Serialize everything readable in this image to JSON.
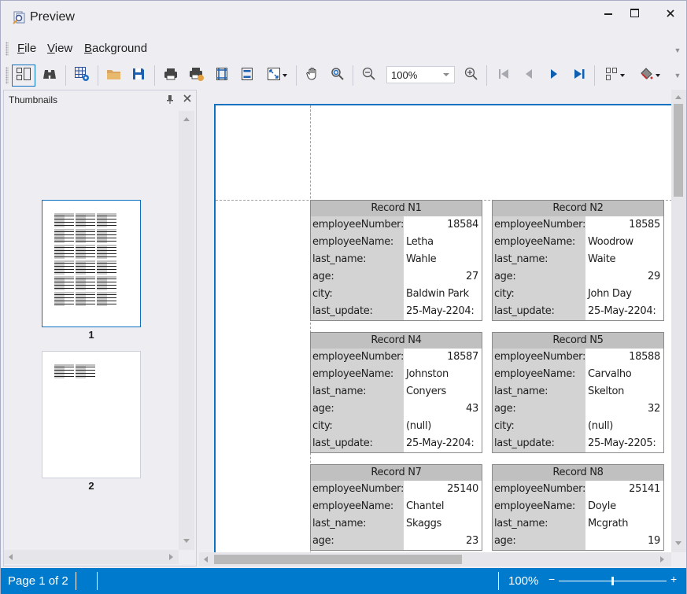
{
  "window": {
    "title": "Preview",
    "icon": "preview-app-icon",
    "controls": [
      "minimize-icon",
      "maximize-icon",
      "close-icon"
    ]
  },
  "menu": {
    "items": [
      {
        "label": "File",
        "mnemonic": "F"
      },
      {
        "label": "View",
        "mnemonic": "V"
      },
      {
        "label": "Background",
        "mnemonic": "B"
      }
    ]
  },
  "toolbar": {
    "buttons": [
      {
        "name": "thumbnails-toggle",
        "icon": "thumbnails-icon",
        "active": true
      },
      {
        "name": "find",
        "icon": "binoculars-icon"
      },
      {
        "name": "parameters",
        "icon": "grid-gear-icon"
      },
      {
        "name": "open",
        "icon": "folder-open-icon"
      },
      {
        "name": "save",
        "icon": "save-icon"
      },
      {
        "name": "print",
        "icon": "printer-icon"
      },
      {
        "name": "quick-print",
        "icon": "quick-print-icon"
      },
      {
        "name": "page-setup",
        "icon": "page-margins-icon"
      },
      {
        "name": "header-footer",
        "icon": "header-footer-icon"
      },
      {
        "name": "scale",
        "icon": "scale-icon",
        "dropdown": true
      },
      {
        "name": "hand-tool",
        "icon": "hand-icon"
      },
      {
        "name": "magnifier",
        "icon": "magnifier-icon"
      },
      {
        "name": "zoom-out",
        "icon": "zoom-out-icon"
      },
      {
        "name": "zoom-in",
        "icon": "zoom-in-icon"
      },
      {
        "name": "first-page",
        "icon": "first-page-icon",
        "disabled": true
      },
      {
        "name": "previous-page",
        "icon": "previous-page-icon",
        "disabled": true
      },
      {
        "name": "next-page",
        "icon": "next-page-icon"
      },
      {
        "name": "last-page",
        "icon": "last-page-icon"
      },
      {
        "name": "multiple-pages",
        "icon": "multiple-pages-icon",
        "dropdown": true
      },
      {
        "name": "page-color",
        "icon": "paint-bucket-icon",
        "dropdown": true
      }
    ],
    "zoom_value": "100%"
  },
  "thumbnails": {
    "title": "Thumbnails",
    "pages": [
      {
        "label": "1",
        "selected": true,
        "records": 18
      },
      {
        "label": "2",
        "selected": false,
        "records": 2
      }
    ]
  },
  "records": [
    {
      "title": "Record N1",
      "employeeNumber": "18584",
      "employeeName": "Letha",
      "last_name": "Wahle",
      "age": "27",
      "city": "Baldwin Park",
      "last_update": "25-May-2204:"
    },
    {
      "title": "Record N2",
      "employeeNumber": "18585",
      "employeeName": "Woodrow",
      "last_name": "Waite",
      "age": "29",
      "city": "John Day",
      "last_update": "25-May-2204:"
    },
    {
      "title": "Record N4",
      "employeeNumber": "18587",
      "employeeName": "Johnston",
      "last_name": "Conyers",
      "age": "43",
      "city": "(null)",
      "last_update": "25-May-2204:"
    },
    {
      "title": "Record N5",
      "employeeNumber": "18588",
      "employeeName": "Carvalho",
      "last_name": "Skelton",
      "age": "32",
      "city": "(null)",
      "last_update": "25-May-2205:"
    },
    {
      "title": "Record N7",
      "employeeNumber": "25140",
      "employeeName": "Chantel",
      "last_name": "Skaggs",
      "age": "23"
    },
    {
      "title": "Record N8",
      "employeeNumber": "25141",
      "employeeName": "Doyle",
      "last_name": "Mcgrath",
      "age": "19"
    }
  ],
  "field_labels": {
    "employeeNumber": "employeeNumber:",
    "employeeName": "employeeName:",
    "last_name": "last_name:",
    "age": "age:",
    "city": "city:",
    "last_update": "last_update:"
  },
  "statusbar": {
    "page_info": "Page 1 of 2",
    "zoom": "100%",
    "zoom_minus": "−",
    "zoom_plus": "+",
    "zoom_slider_fraction": 0.5
  },
  "colors": {
    "accent": "#007acc",
    "selection_border": "#0e70c0",
    "header_gray": "#c0c0c0",
    "label_gray": "#d3d3d3"
  }
}
